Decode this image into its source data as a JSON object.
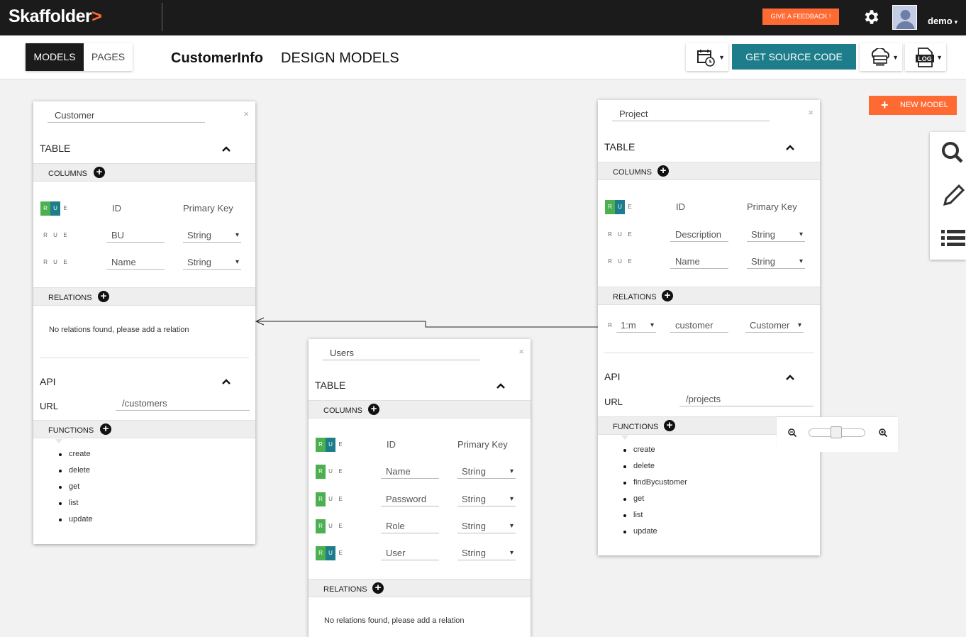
{
  "topbar": {
    "logo_text": "Skaffolder",
    "logo_mark": ">",
    "feedback_label": "GIVE A FEEDBACK !",
    "username": "demo"
  },
  "subbar": {
    "tabs": {
      "models": "MODELS",
      "pages": "PAGES"
    },
    "project_title": "CustomerInfo",
    "page_title": "DESIGN MODELS",
    "source_button": "GET SOURCE CODE",
    "log_label": "LOG"
  },
  "new_model_label": "NEW MODEL",
  "rue_letters": {
    "r": "R",
    "u": "U",
    "e": "E"
  },
  "labels": {
    "table": "TABLE",
    "columns": "COLUMNS",
    "relations": "RELATIONS",
    "api": "API",
    "url": "URL",
    "functions": "FUNCTIONS",
    "no_relations": "No relations found, please add a relation",
    "close": "×"
  },
  "models": {
    "customer": {
      "name": "Customer",
      "columns": [
        {
          "name": "ID",
          "type": "Primary Key"
        },
        {
          "name": "BU",
          "type": "String"
        },
        {
          "name": "Name",
          "type": "String"
        }
      ],
      "url": "/customers",
      "functions": [
        "create",
        "delete",
        "get",
        "list",
        "update"
      ]
    },
    "project": {
      "name": "Project",
      "columns": [
        {
          "name": "ID",
          "type": "Primary Key"
        },
        {
          "name": "Description",
          "type": "String"
        },
        {
          "name": "Name",
          "type": "String"
        }
      ],
      "relation": {
        "cardinality": "1:m",
        "name": "customer",
        "target": "Customer"
      },
      "url": "/projects",
      "functions": [
        "create",
        "delete",
        "findBycustomer",
        "get",
        "list",
        "update"
      ]
    },
    "users": {
      "name": "Users",
      "columns": [
        {
          "name": "ID",
          "type": "Primary Key"
        },
        {
          "name": "Name",
          "type": "String"
        },
        {
          "name": "Password",
          "type": "String"
        },
        {
          "name": "Role",
          "type": "String"
        },
        {
          "name": "User",
          "type": "String"
        }
      ]
    }
  }
}
